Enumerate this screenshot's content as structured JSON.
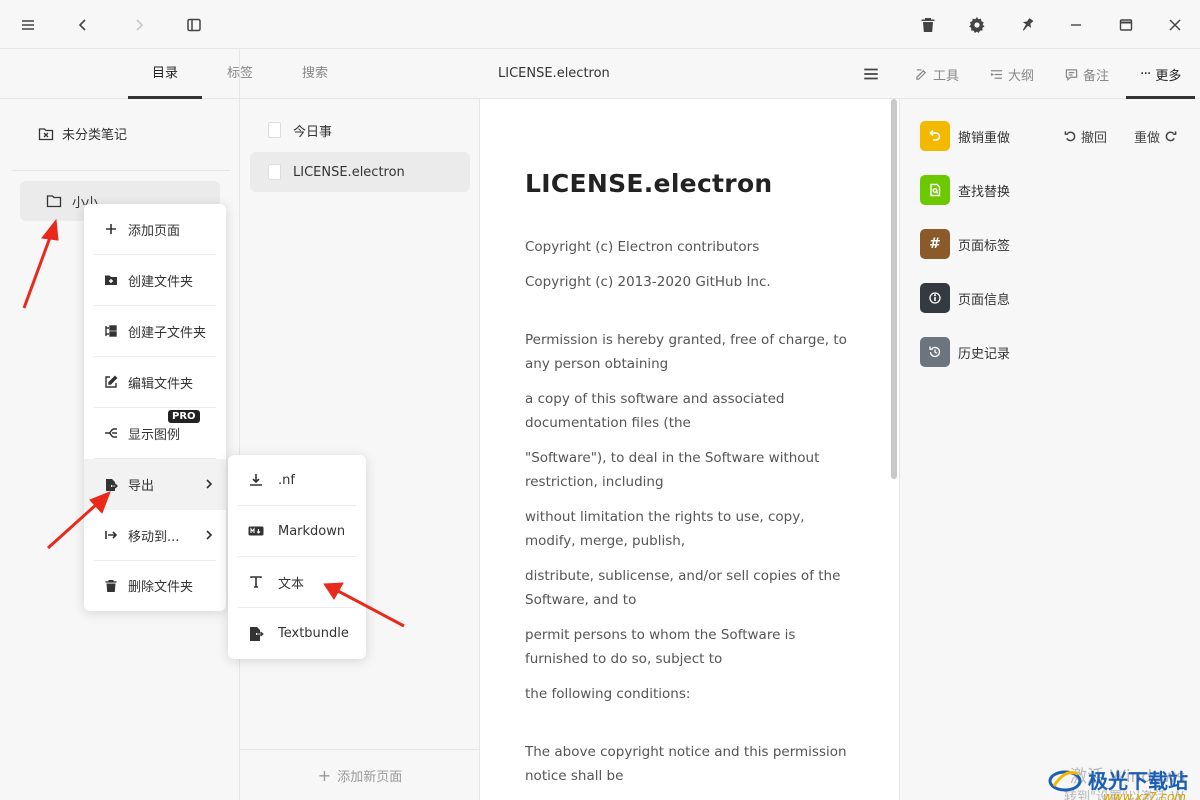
{
  "topbar": {
    "menu_icon": "hamburger-icon",
    "back_icon": "chevron-left-icon",
    "forward_icon": "chevron-right-icon",
    "sidebar_icon": "sidebar-toggle-icon",
    "trash_icon": "trash-icon",
    "settings_icon": "gear-icon",
    "pin_icon": "pin-icon"
  },
  "left_tabs": [
    {
      "label": "目录",
      "active": true
    },
    {
      "label": "标签",
      "active": false
    },
    {
      "label": "搜索",
      "active": false
    }
  ],
  "sidebar": {
    "uncategorized": "未分类笔记",
    "folder": "小小"
  },
  "context_menu": {
    "items": [
      {
        "label": "添加页面",
        "icon": "plus-icon"
      },
      {
        "label": "创建文件夹",
        "icon": "folder-plus-icon"
      },
      {
        "label": "创建子文件夹",
        "icon": "subfolder-icon"
      },
      {
        "label": "编辑文件夹",
        "icon": "edit-icon"
      },
      {
        "label": "显示图例",
        "icon": "legend-icon"
      },
      {
        "label": "导出",
        "icon": "export-icon"
      },
      {
        "label": "移动到...",
        "icon": "move-icon"
      },
      {
        "label": "删除文件夹",
        "icon": "trash-icon"
      }
    ],
    "pro_badge": "PRO"
  },
  "export_submenu": {
    "items": [
      {
        "label": ".nf",
        "icon": "download-icon"
      },
      {
        "label": "Markdown",
        "icon": "markdown-icon"
      },
      {
        "label": "文本",
        "icon": "text-icon"
      },
      {
        "label": "Textbundle",
        "icon": "export-file-icon"
      }
    ]
  },
  "notes": {
    "items": [
      {
        "label": "今日事"
      },
      {
        "label": "LICENSE.electron"
      }
    ],
    "add_page": "添加新页面"
  },
  "document": {
    "header_title": "LICENSE.electron",
    "title": "LICENSE.electron",
    "paragraphs": [
      "Copyright (c) Electron contributors",
      "Copyright (c) 2013-2020 GitHub Inc.",
      "Permission is hereby granted, free of charge, to any person obtaining",
      "a copy of this software and associated documentation files (the",
      "\"Software\"), to deal in the Software without restriction, including",
      "without limitation the rights to use, copy, modify, merge, publish,",
      "distribute, sublicense, and/or sell copies of the Software, and to",
      "permit persons to whom the Software is furnished to do so, subject to",
      "the following conditions:",
      "The above copyright notice and this permission notice shall be"
    ]
  },
  "right_tabs": [
    {
      "label": "工具",
      "icon": "edit-icon",
      "active": false
    },
    {
      "label": "大纲",
      "icon": "outline-icon",
      "active": false
    },
    {
      "label": "备注",
      "icon": "comment-icon",
      "active": false
    },
    {
      "label": "更多",
      "icon": "more-icon",
      "active": true
    }
  ],
  "tools": [
    {
      "label": "撤销重做",
      "color": "#f5b800",
      "icon": "undo-icon"
    },
    {
      "label": "查找替换",
      "color": "#6cc900",
      "icon": "find-replace-icon"
    },
    {
      "label": "页面标签",
      "color": "#8a5a2b",
      "icon": "hash-icon",
      "glyph": "#"
    },
    {
      "label": "页面信息",
      "color": "#353a40",
      "icon": "info-icon"
    },
    {
      "label": "历史记录",
      "color": "#6c757d",
      "icon": "history-icon"
    }
  ],
  "undo_redo": {
    "undo": "撤回",
    "redo": "重做"
  },
  "watermark": {
    "brand": "极光下载站",
    "url": "www.xz7.com",
    "activate_line1": "激活 Windows",
    "activate_line2": "转到\"设置\"以激活 W"
  },
  "colors": {
    "accent_dark": "#333333",
    "annotation_red": "#e8291c"
  }
}
